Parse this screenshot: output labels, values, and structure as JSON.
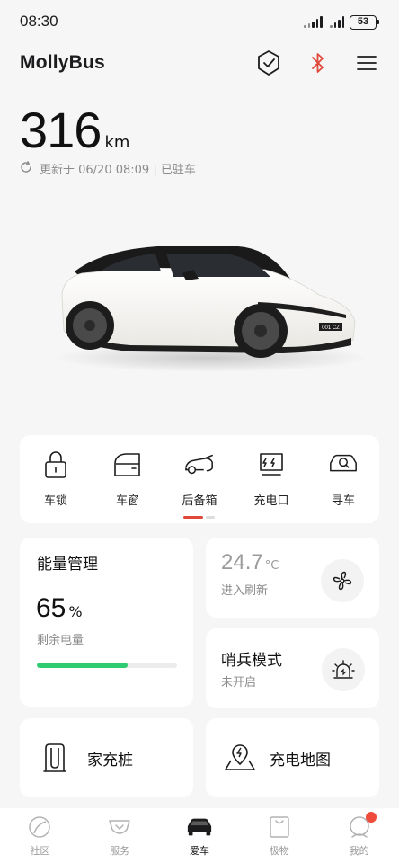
{
  "status_bar": {
    "time": "08:30",
    "battery": "53"
  },
  "header": {
    "title": "MollyBus",
    "icons": [
      "shield-check-icon",
      "bluetooth-icon",
      "menu-icon"
    ],
    "bluetooth_color": "#e0483a"
  },
  "vehicle": {
    "range_value": "316",
    "range_unit": "km",
    "update_text": "更新于 06/20 08:09 | 已驻车",
    "plate_text": "001 CZ"
  },
  "controls": [
    {
      "label": "车锁",
      "icon": "lock-icon"
    },
    {
      "label": "车窗",
      "icon": "car-window-icon"
    },
    {
      "label": "后备箱",
      "icon": "trunk-icon"
    },
    {
      "label": "充电口",
      "icon": "charge-port-icon"
    },
    {
      "label": "寻车",
      "icon": "find-car-icon"
    }
  ],
  "controls_page_indicator": {
    "active_color": "#e0483a",
    "inactive_color": "#dddddd",
    "active_index": 0,
    "count": 2
  },
  "energy": {
    "title": "能量管理",
    "percent_value": "65",
    "percent_unit": "%",
    "subtitle": "剩余电量",
    "level_fraction": 0.65,
    "bar_color": "#2ecc71"
  },
  "climate": {
    "temp_value": "24.7",
    "temp_unit": "°C",
    "subtitle": "进入刷新",
    "icon": "fan-icon"
  },
  "sentry": {
    "title": "哨兵模式",
    "subtitle": "未开启",
    "icon": "siren-icon"
  },
  "features": [
    {
      "label": "家充桩",
      "icon": "home-charger-icon"
    },
    {
      "label": "充电地图",
      "icon": "charging-map-icon"
    }
  ],
  "nav": [
    {
      "label": "社区",
      "icon": "community-icon",
      "active": false
    },
    {
      "label": "服务",
      "icon": "service-icon",
      "active": false
    },
    {
      "label": "爱车",
      "icon": "car-icon",
      "active": true
    },
    {
      "label": "极物",
      "icon": "shopping-bag-icon",
      "active": false
    },
    {
      "label": "我的",
      "icon": "profile-icon",
      "active": false
    }
  ],
  "notification_color": "#ef4b3a"
}
